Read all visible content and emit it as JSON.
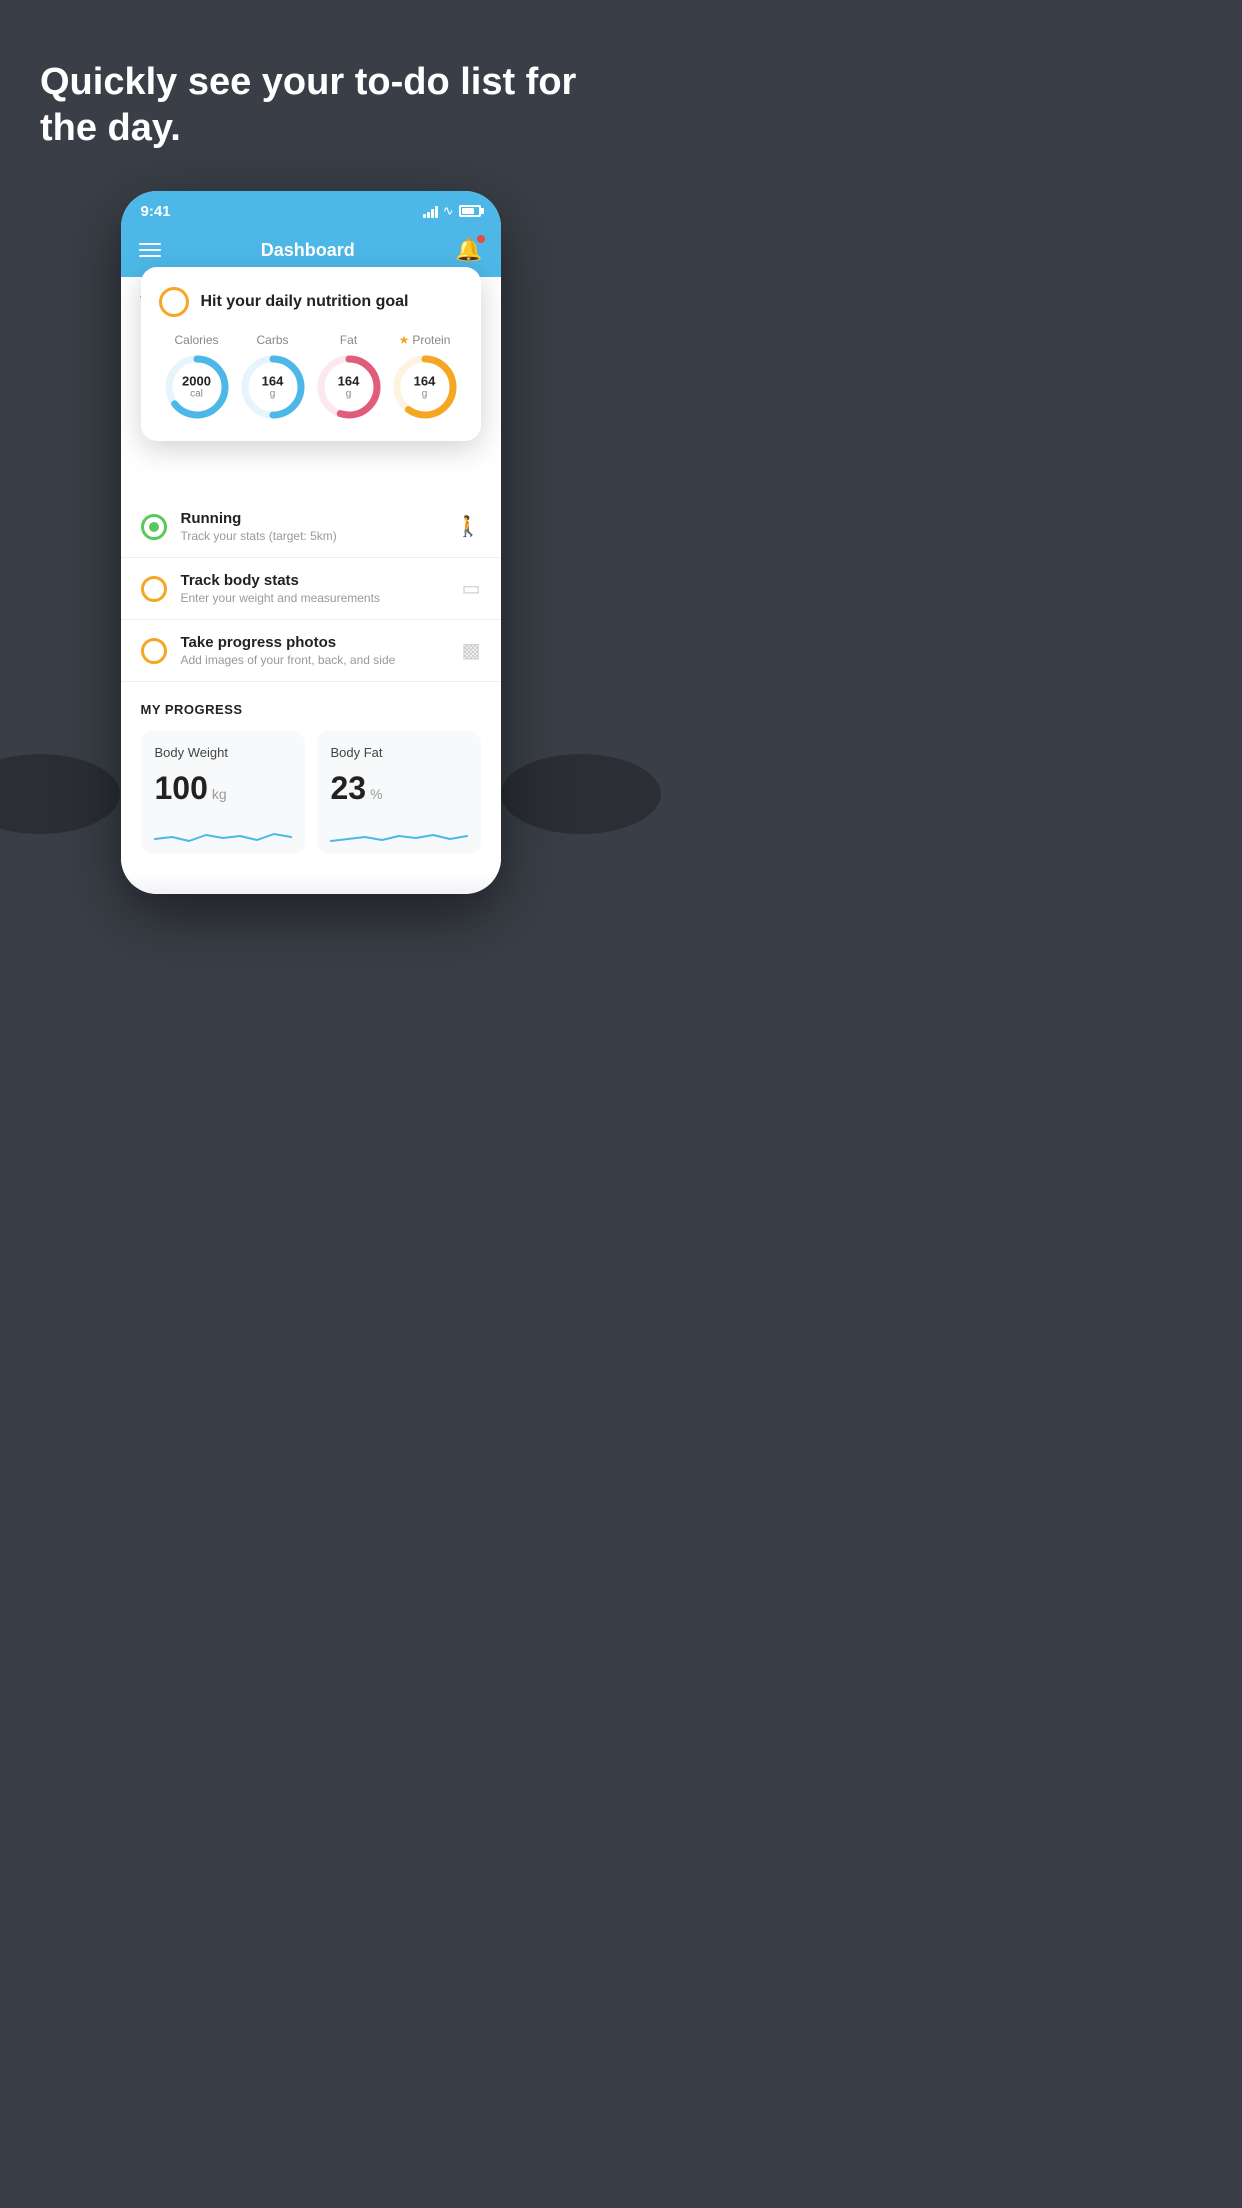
{
  "hero": {
    "title": "Quickly see your to-do list for the day."
  },
  "phone": {
    "status_bar": {
      "time": "9:41"
    },
    "header": {
      "title": "Dashboard"
    },
    "things_section": {
      "label": "THINGS TO DO TODAY"
    },
    "floating_card": {
      "title": "Hit your daily nutrition goal",
      "stats": [
        {
          "label": "Calories",
          "value": "2000",
          "unit": "cal",
          "color": "#4db8e8",
          "pct": 65,
          "star": false
        },
        {
          "label": "Carbs",
          "value": "164",
          "unit": "g",
          "color": "#4db8e8",
          "pct": 50,
          "star": false
        },
        {
          "label": "Fat",
          "value": "164",
          "unit": "g",
          "color": "#e05c7a",
          "pct": 55,
          "star": false
        },
        {
          "label": "Protein",
          "value": "164",
          "unit": "g",
          "color": "#f5a623",
          "pct": 60,
          "star": true
        }
      ]
    },
    "todo_items": [
      {
        "title": "Running",
        "subtitle": "Track your stats (target: 5km)",
        "completed": true,
        "circle_color": "green"
      },
      {
        "title": "Track body stats",
        "subtitle": "Enter your weight and measurements",
        "completed": false,
        "circle_color": "yellow"
      },
      {
        "title": "Take progress photos",
        "subtitle": "Add images of your front, back, and side",
        "completed": false,
        "circle_color": "yellow"
      }
    ],
    "progress": {
      "header": "MY PROGRESS",
      "cards": [
        {
          "title": "Body Weight",
          "value": "100",
          "unit": "kg"
        },
        {
          "title": "Body Fat",
          "value": "23",
          "unit": "%"
        }
      ]
    }
  }
}
